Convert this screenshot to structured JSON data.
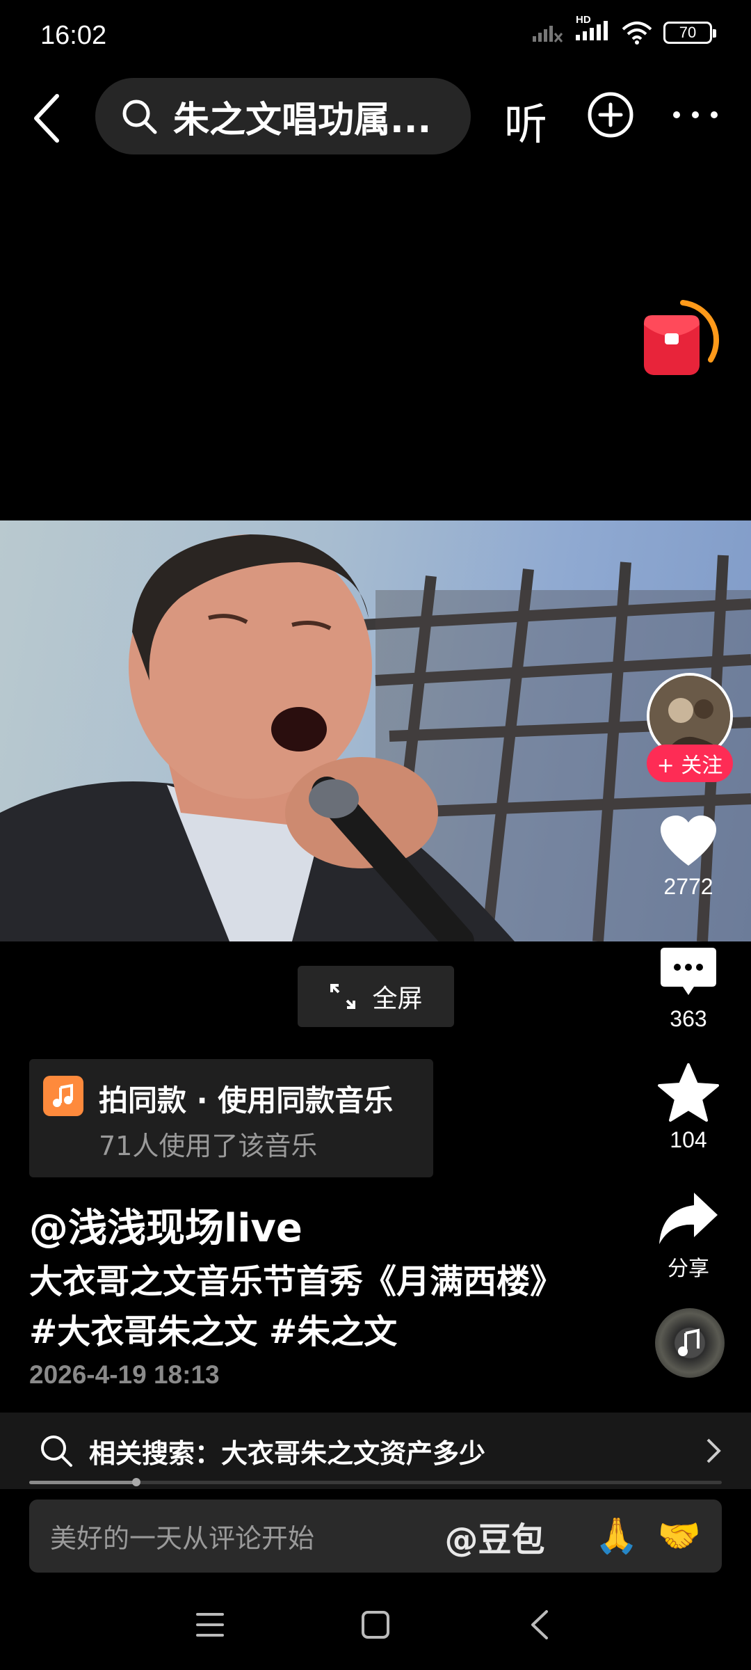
{
  "status_bar": {
    "time": "16:02",
    "battery": "70",
    "network": "HD"
  },
  "top_bar": {
    "search_query": "朱之文唱功属...",
    "listen_label": "听"
  },
  "video": {
    "fullscreen_label": "全屏"
  },
  "side_actions": {
    "follow_label": "+ 关注",
    "like_count": "2772",
    "comment_count": "363",
    "favorite_count": "104",
    "share_label": "分享"
  },
  "music": {
    "title": "拍同款 · 使用同款音乐",
    "usage": "71人使用了该音乐"
  },
  "post": {
    "author": "@浅浅现场live",
    "description": "大衣哥之文音乐节首秀《月满西楼》#大衣哥朱之文 #朱之文",
    "date": "2026-4-19 18:13"
  },
  "related_search": {
    "text": "相关搜索：大衣哥朱之文资产多少"
  },
  "playback": {
    "progress_fraction": 0.155
  },
  "comment_bar": {
    "placeholder": "美好的一天从评论开始",
    "mention": "@豆包",
    "emoji_1": "🙏",
    "emoji_2": "🤝"
  },
  "colors": {
    "accent_red": "#fe2c55",
    "music_orange": "#fe8a3c"
  }
}
